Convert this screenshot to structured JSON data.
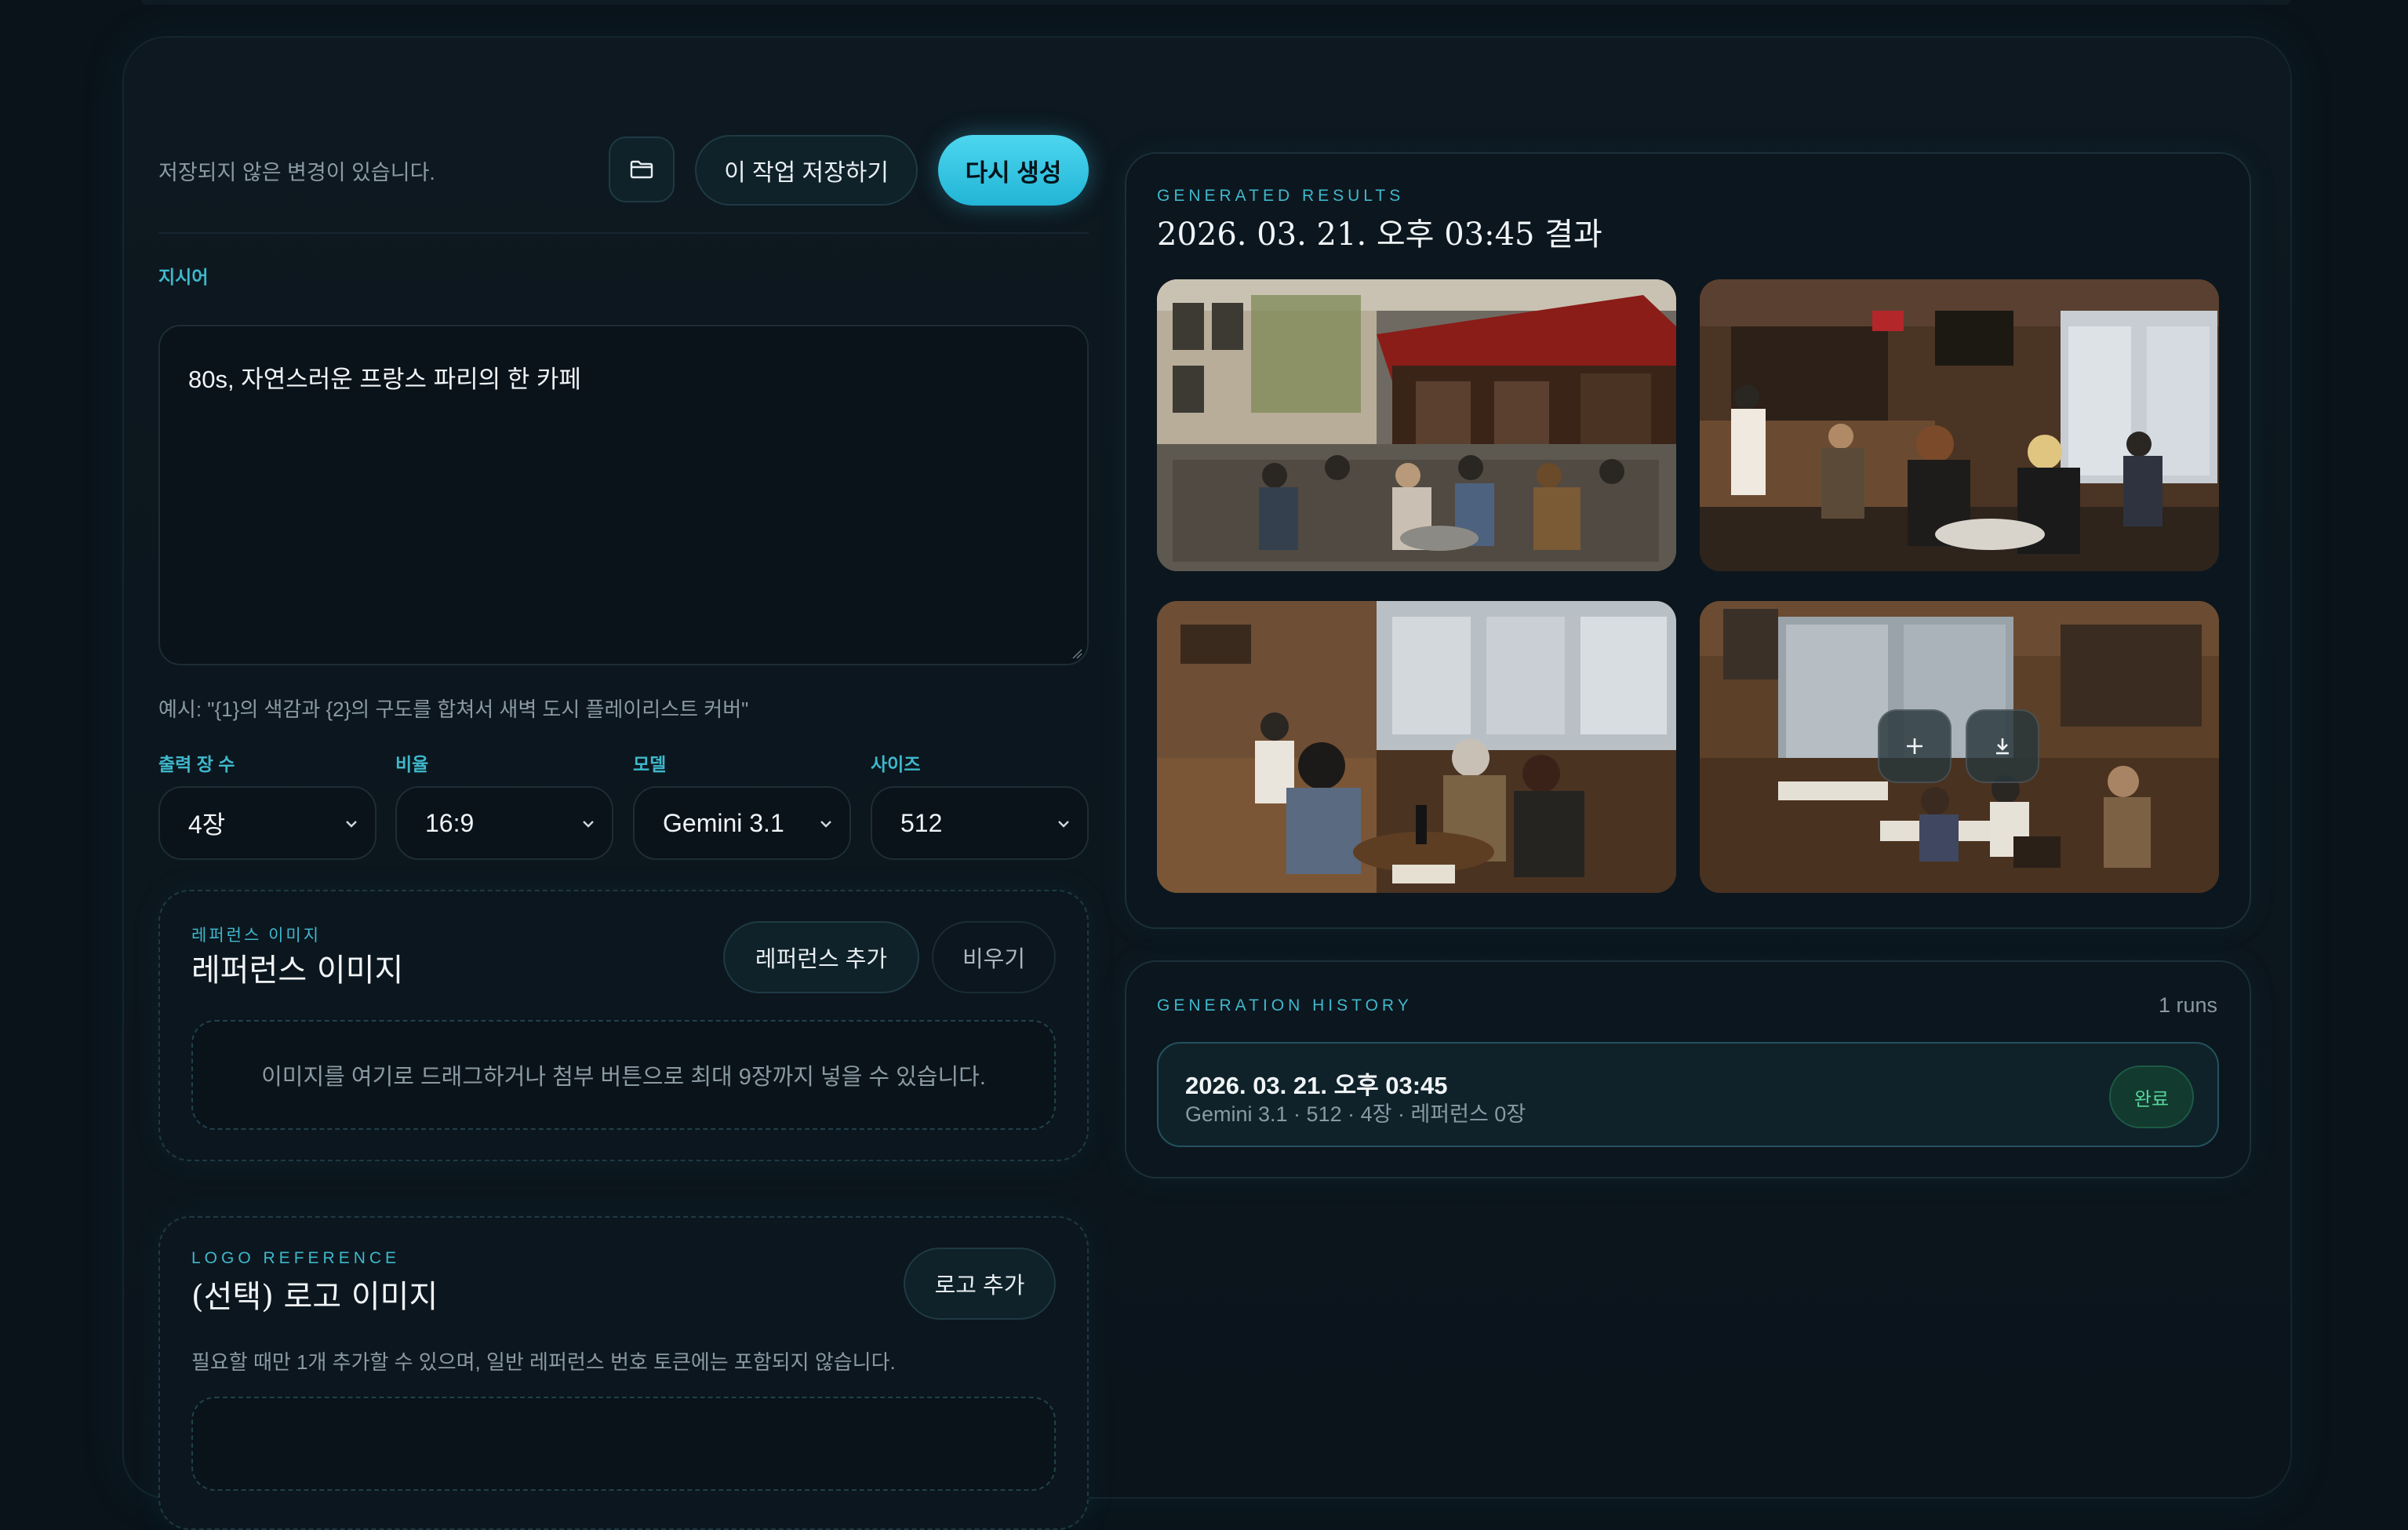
{
  "toolbar": {
    "unsaved_notice": "저장되지 않은 변경이 있습니다.",
    "save_label": "이 작업 저장하기",
    "regenerate_label": "다시 생성"
  },
  "prompt": {
    "label": "지시어",
    "value": "80s, 자연스러운 프랑스 파리의 한 카페",
    "hint": "예시: \"{1}의 색감과 {2}의 구도를 합쳐서 새벽 도시 플레이리스트 커버\""
  },
  "options": {
    "count": {
      "label": "출력 장 수",
      "value": "4장"
    },
    "ratio": {
      "label": "비율",
      "value": "16:9"
    },
    "model": {
      "label": "모델",
      "value": "Gemini 3.1"
    },
    "size": {
      "label": "사이즈",
      "value": "512"
    }
  },
  "reference": {
    "eyebrow": "레퍼런스 이미지",
    "title": "레퍼런스 이미지",
    "add_label": "레퍼런스 추가",
    "clear_label": "비우기",
    "dropzone_text": "이미지를 여기로 드래그하거나 첨부 버튼으로 최대 9장까지 넣을 수 있습니다."
  },
  "logo": {
    "eyebrow": "LOGO REFERENCE",
    "title": "(선택) 로고 이미지",
    "add_label": "로고 추가",
    "description": "필요할 때만 1개 추가할 수 있으며, 일반 레퍼런스 번호 토큰에는 포함되지 않습니다."
  },
  "results": {
    "eyebrow": "GENERATED RESULTS",
    "title": "2026. 03. 21. 오후 03:45 결과",
    "images": [
      {
        "name": "cafe-exterior-terrace"
      },
      {
        "name": "cafe-interior-bar"
      },
      {
        "name": "cafe-interior-group"
      },
      {
        "name": "cafe-interior-window"
      }
    ]
  },
  "history": {
    "eyebrow": "GENERATION HISTORY",
    "runs": "1 runs",
    "items": [
      {
        "title": "2026. 03. 21. 오후 03:45",
        "meta": "Gemini 3.1 · 512 · 4장 · 레퍼런스 0장",
        "status": "완료"
      }
    ]
  },
  "colors": {
    "accent": "#3fb8cc",
    "primary_button": "#2ec4e2",
    "success": "#56d49c",
    "background": "#0a131a"
  }
}
